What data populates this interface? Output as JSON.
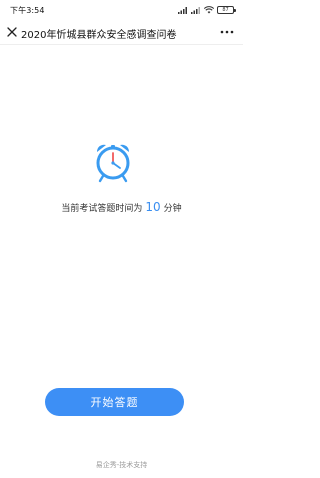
{
  "status_bar": {
    "time": "下午3:54",
    "battery": "87"
  },
  "nav": {
    "title": "2020年忻城县群众安全感调查问卷",
    "close_icon": "close-icon",
    "more_icon": "more-icon"
  },
  "content": {
    "clock_icon": "alarm-clock-icon",
    "duration_prefix": "当前考试答题时间为",
    "duration_value": "10",
    "duration_unit": "分钟"
  },
  "start_button_label": "开始答题",
  "footer_text": "易企秀-技术支持",
  "colors": {
    "accent": "#3d8ff5",
    "clock_blue": "#3a9bf0",
    "clock_hand_red": "#f25a5a"
  }
}
